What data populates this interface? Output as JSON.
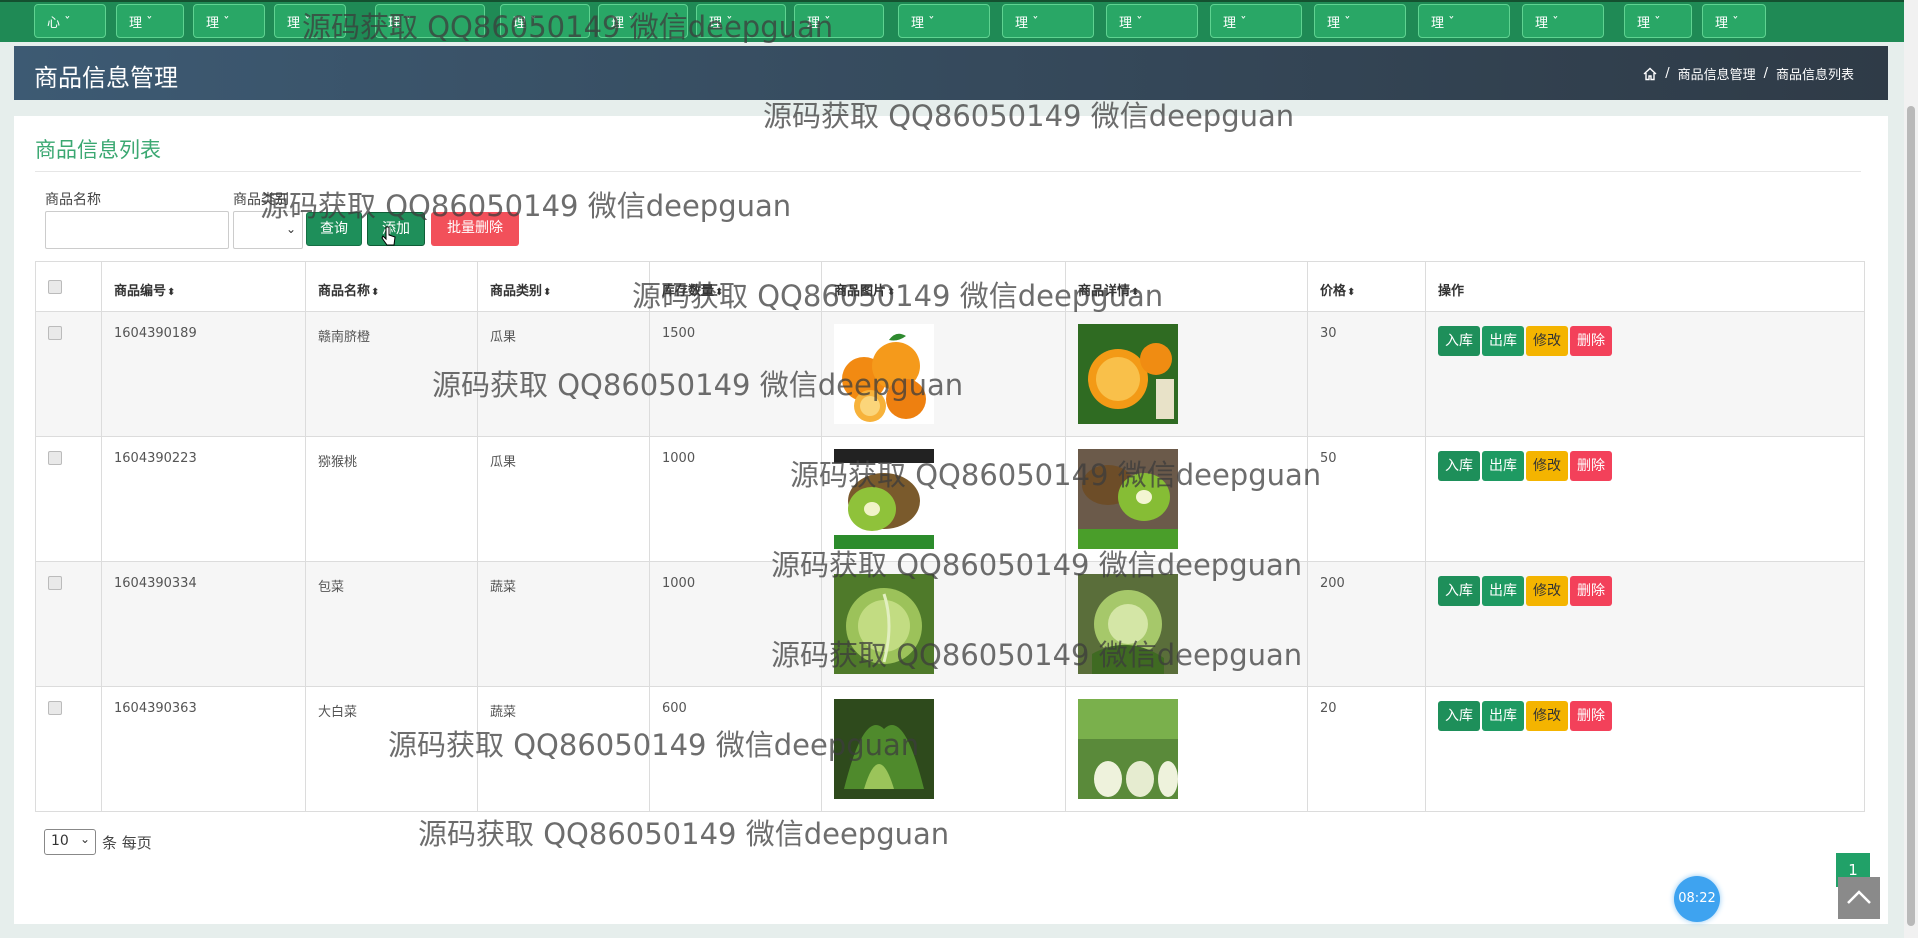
{
  "topnav": {
    "items": [
      {
        "label": "心 ˇ"
      },
      {
        "label": "理 ˇ"
      },
      {
        "label": "理 ˇ"
      },
      {
        "label": "理 ˇ"
      },
      {
        "label": "理 ˇ"
      },
      {
        "label": "理 ˇ"
      },
      {
        "label": "理 ˇ"
      },
      {
        "label": "理 ˇ"
      },
      {
        "label": "理 ˇ"
      },
      {
        "label": "理 ˇ"
      },
      {
        "label": "理 ˇ"
      },
      {
        "label": "理 ˇ"
      },
      {
        "label": "理 ˇ"
      },
      {
        "label": "理 ˇ"
      },
      {
        "label": "理 ˇ"
      },
      {
        "label": "理 ˇ"
      },
      {
        "label": "理 ˇ"
      },
      {
        "label": "理 ˇ"
      }
    ]
  },
  "header": {
    "title": "商品信息管理",
    "breadcrumb": [
      "商品信息管理",
      "商品信息列表"
    ],
    "separator": "/"
  },
  "card": {
    "title": "商品信息列表"
  },
  "search": {
    "name_label": "商品名称",
    "category_label": "商品类别",
    "name_value": "",
    "category_value": "",
    "query_button": "查询",
    "add_button": "添加",
    "bulk_delete_button": "批量删除"
  },
  "table": {
    "columns": [
      "商品编号",
      "商品名称",
      "商品类别",
      "库存数量",
      "商品图片",
      "商品详情",
      "价格",
      "操作"
    ],
    "sort_glyph": "⬍",
    "rows": [
      {
        "id": "1604390189",
        "name": "赣南脐橙",
        "category": "瓜果",
        "stock": "1500",
        "price": "30"
      },
      {
        "id": "1604390223",
        "name": "猕猴桃",
        "category": "瓜果",
        "stock": "1000",
        "price": "50"
      },
      {
        "id": "1604390334",
        "name": "包菜",
        "category": "蔬菜",
        "stock": "1000",
        "price": "200"
      },
      {
        "id": "1604390363",
        "name": "大白菜",
        "category": "蔬菜",
        "stock": "600",
        "price": "20"
      }
    ],
    "actions": {
      "stock_in": "入库",
      "stock_out": "出库",
      "edit": "修改",
      "delete": "删除"
    }
  },
  "pagination": {
    "page_size": "10",
    "page_size_label": "条 每页",
    "current_page": "1"
  },
  "clock": {
    "time": "08:22"
  },
  "watermark": "源码获取 QQ86050149 微信deepguan",
  "colors": {
    "nav_green": "#1f8a55",
    "accent_green": "#3ba872",
    "danger": "#f3415a",
    "warning": "#f4b400"
  }
}
